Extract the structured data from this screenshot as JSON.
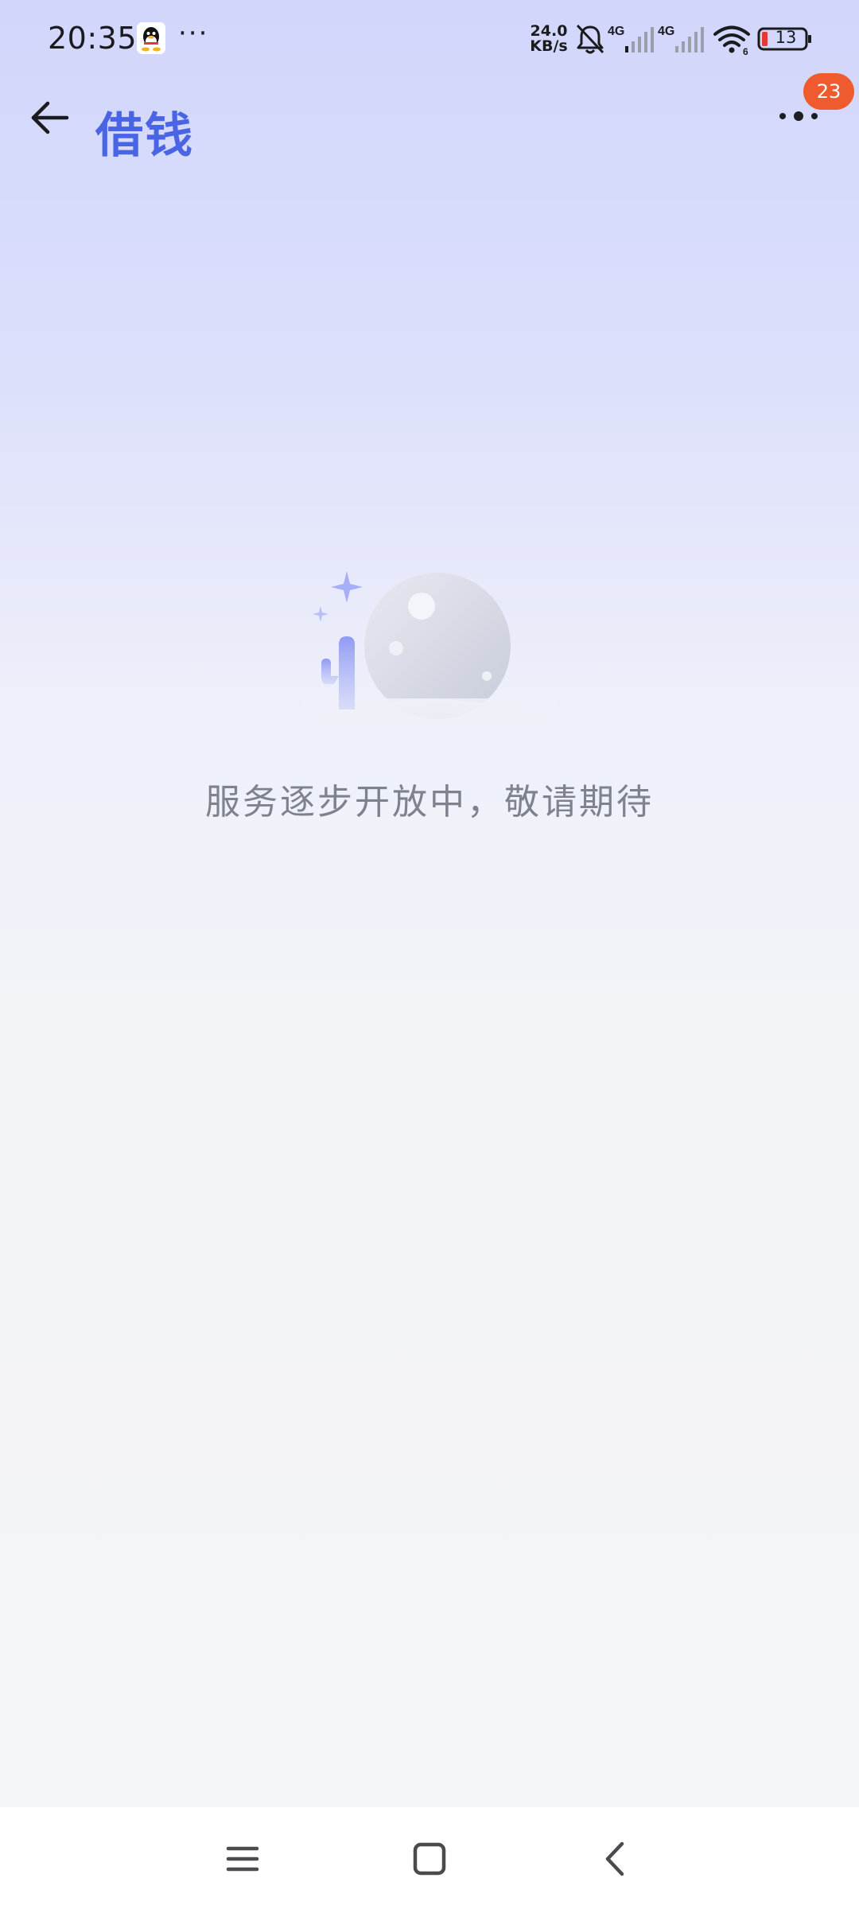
{
  "status_bar": {
    "time": "20:35",
    "notification_icons": [
      "qq-icon",
      "more-dots-icon"
    ],
    "net_speed_value": "24.0",
    "net_speed_unit": "KB/s",
    "signal_1_label": "4G",
    "signal_2_label": "4G",
    "wifi_label": "6",
    "battery_level": "13",
    "icons": [
      "bell-muted-icon",
      "signal-icon",
      "signal-icon",
      "wifi-icon",
      "battery-icon"
    ],
    "colors": {
      "battery_low": "#e53935"
    }
  },
  "header": {
    "title": "借钱",
    "back_icon": "back-arrow-icon",
    "more_icon": "more-dots-icon",
    "badge_count": "23",
    "colors": {
      "title": "#4a64e6",
      "badge": "#ef5a2e"
    }
  },
  "empty_state": {
    "illustration": "moon-cactus-illustration",
    "message": "服务逐步开放中，敬请期待"
  },
  "nav_bar": {
    "icons": [
      "menu-icon",
      "home-icon",
      "back-icon"
    ]
  }
}
